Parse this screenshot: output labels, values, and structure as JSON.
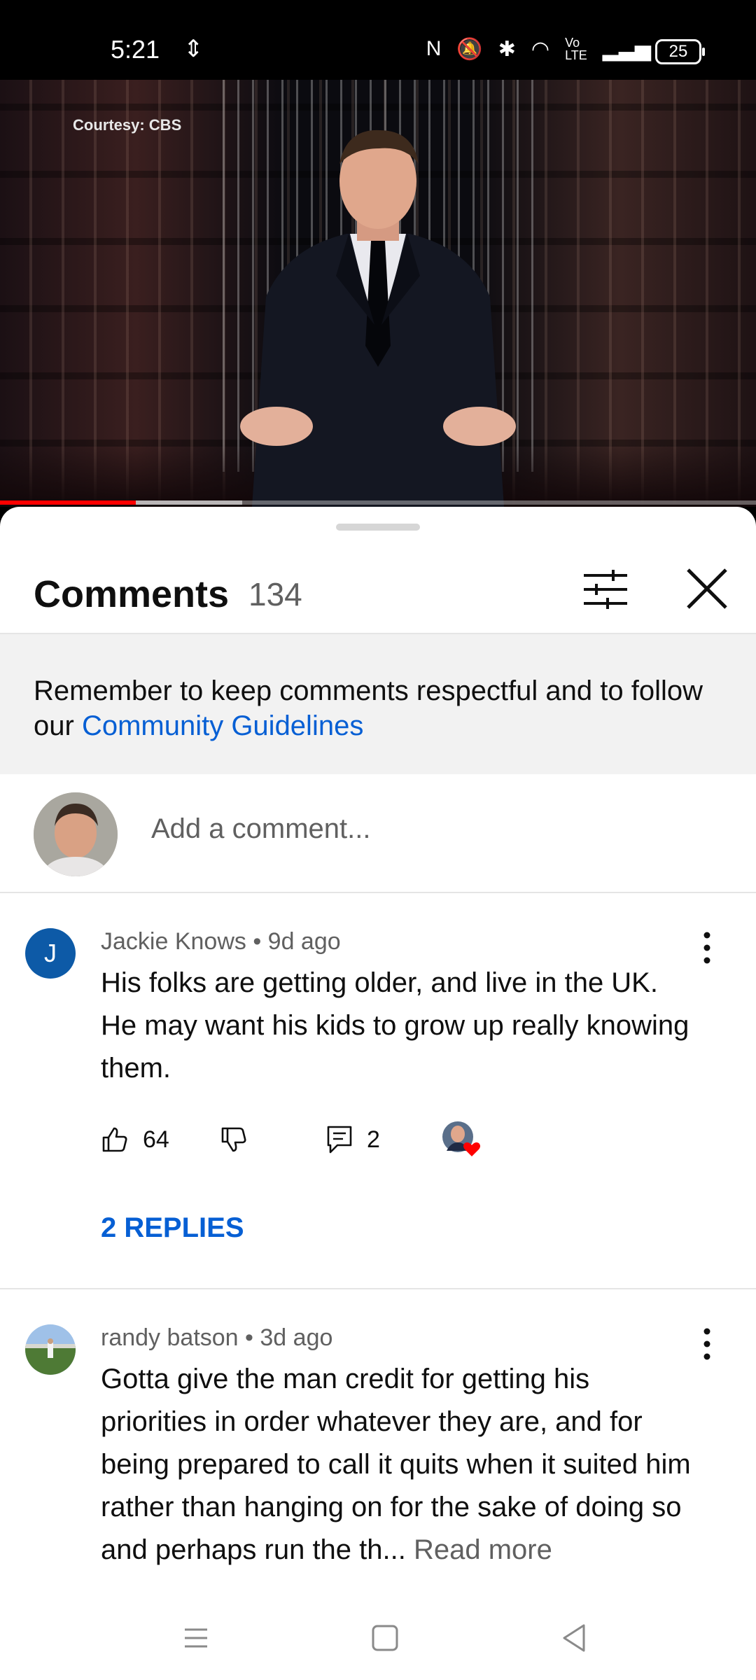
{
  "status_bar": {
    "time": "5:21",
    "battery": "25"
  },
  "video": {
    "watermark": "Courtesy: CBS",
    "progress_played": 0.18,
    "progress_buffered": 0.32
  },
  "comments_header": {
    "title": "Comments",
    "count": "134"
  },
  "notice": {
    "text": "Remember to keep comments respectful and to follow our ",
    "link": "Community Guidelines"
  },
  "add_comment": {
    "placeholder": "Add a comment..."
  },
  "comments": [
    {
      "author": "Jackie Knows",
      "age": "9d ago",
      "avatar_letter": "J",
      "avatar_color": "#0d5aa7",
      "text": "His  folks are getting older, and live in the UK. He may want his kids to grow up really knowing them.",
      "likes": "64",
      "replies_count": "2",
      "replies_label": "2 REPLIES"
    },
    {
      "author": "randy batson",
      "age": "3d ago",
      "text": "Gotta give the man credit for getting his priorities in order whatever they are, and for being prepared to call it quits when it suited him rather than hanging on for the sake of doing so and perhaps run the th...",
      "read_more": "Read more"
    }
  ],
  "colors": {
    "link": "#065fd4",
    "progress": "#ff0000",
    "secondary_text": "#606060"
  }
}
